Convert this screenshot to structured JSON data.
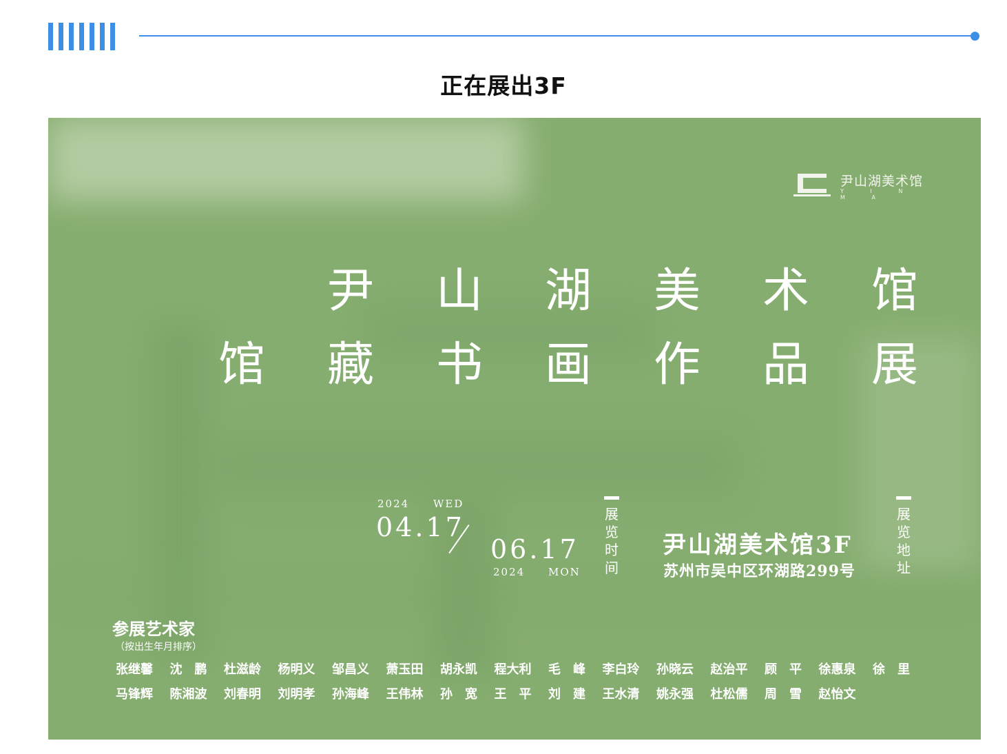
{
  "section": {
    "title": "正在展出3F"
  },
  "poster": {
    "logo": {
      "name": "尹山湖美术馆",
      "sub": "Y I N M A"
    },
    "title_line1": [
      "尹",
      "山",
      "湖",
      "美",
      "术",
      "馆"
    ],
    "title_line2": [
      "馆",
      "藏",
      "书",
      "画",
      "作",
      "品",
      "展"
    ],
    "start": {
      "year": "2024",
      "weekday": "WED",
      "date": "04.17"
    },
    "end": {
      "year": "2024",
      "weekday": "MON",
      "date": "06.17"
    },
    "time_label": "展览时间",
    "venue": "尹山湖美术馆3F",
    "address": "苏州市吴中区环湖路299号",
    "address_label": "展览地址",
    "artists_heading": "参展艺术家",
    "artists_note": "（按出生年月排序）",
    "artists_row1": [
      "张继馨",
      "沈　鹏",
      "杜滋龄",
      "杨明义",
      "邹昌义",
      "萧玉田",
      "胡永凯",
      "程大利",
      "毛　峰",
      "李白玲",
      "孙晓云",
      "赵治平",
      "顾　平",
      "徐惠泉",
      "徐　里"
    ],
    "artists_row2": [
      "马锋辉",
      "陈湘波",
      "刘春明",
      "刘明孝",
      "孙海峰",
      "王伟林",
      "孙　宽",
      "王　平",
      "刘　建",
      "王水清",
      "姚永强",
      "杜松儒",
      "周　雪",
      "赵怡文"
    ]
  },
  "colors": {
    "accent": "#3d8fe6",
    "poster_bg": "#86ad70"
  }
}
